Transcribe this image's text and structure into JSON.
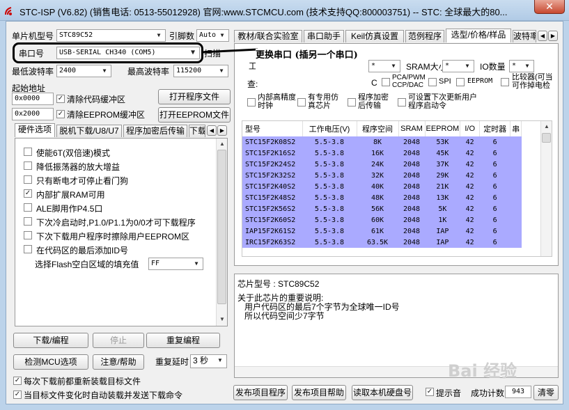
{
  "window": {
    "title": "STC-ISP (V6.82) (销售电话: 0513-55012928) 官网:www.STCMCU.com  (技术支持QQ:800003751)  -- STC: 全球最大的80..."
  },
  "left": {
    "mcu_type_label": "单片机型号",
    "mcu_type_value": "STC89C52",
    "pin_count_label": "引脚数",
    "pin_count_value": "Auto",
    "port_label": "串口号",
    "port_value": "USB-SERIAL CH340 (COM5)",
    "scan_label": "扫描",
    "min_baud_label": "最低波特率",
    "min_baud_value": "2400",
    "max_baud_label": "最高波特率",
    "max_baud_value": "115200",
    "start_addr_label": "起始地址",
    "addr1_value": "0x0000",
    "clear_code_label": "清除代码缓冲区",
    "open_program_label": "打开程序文件",
    "addr2_value": "0x2000",
    "clear_eeprom_label": "清除EEPROM缓冲区",
    "open_eeprom_label": "打开EEPROM文件",
    "tabs": [
      "硬件选项",
      "脱机下载/U8/U7",
      "程序加密后传输",
      "下载"
    ],
    "options": [
      {
        "label": "使能6T(双倍速)模式",
        "checked": false
      },
      {
        "label": "降低振荡器的放大增益",
        "checked": false
      },
      {
        "label": "只有断电才可停止看门狗",
        "checked": false
      },
      {
        "label": "内部扩展RAM可用",
        "checked": true
      },
      {
        "label": "ALE脚用作P4.5口",
        "checked": false
      },
      {
        "label": "下次冷启动时,P1.0/P1.1为0/0才可下载程序",
        "checked": false
      },
      {
        "label": "下次下载用户程序时擦除用户EEPROM区",
        "checked": false
      },
      {
        "label": "在代码区的最后添加ID号",
        "checked": false
      }
    ],
    "fill_label": "选择Flash空白区域的填充值",
    "fill_value": "FF",
    "download_label": "下载/编程",
    "stop_label": "停止",
    "reprogram_label": "重复编程",
    "detect_label": "检测MCU选项",
    "help_label": "注意/帮助",
    "retry_delay_label": "重复延时",
    "retry_delay_value": "3 秒",
    "reload_label": "每次下载前都重新装载目标文件",
    "autoload_label": "当目标文件变化时自动装载并发送下载命令"
  },
  "right": {
    "tabs": [
      "教材/联合实验室",
      "串口助手",
      "Keil仿真设置",
      "范例程序",
      "选型/价格/样品",
      "波特率"
    ],
    "filter": {
      "row1_label_a": "工",
      "any": "*",
      "sram_label": "SRAM大小",
      "io_label": "IO数量",
      "query_label": "查:",
      "c_label": "C",
      "pca_label": "PCA/PWM CCP/DAC",
      "spi_label": "SPI",
      "eeprom_label": "EEPROM",
      "comparator_label": "比较器(可当可作掉电检",
      "internal_clock_label": "内部高精度时钟",
      "emulator_label": "有专用仿真芯片",
      "encrypted_label": "程序加密后传输",
      "settable_label": "可设置下次更新用户程序启动令"
    },
    "table": {
      "headers": [
        "型号",
        "工作电压(V)",
        "程序空间",
        "SRAM",
        "EEPROM",
        "I/O",
        "定时器",
        "串"
      ],
      "rows": [
        [
          "STC15F2K08S2",
          "5.5-3.8",
          "8K",
          "2048",
          "53K",
          "42",
          "6"
        ],
        [
          "STC15F2K16S2",
          "5.5-3.8",
          "16K",
          "2048",
          "45K",
          "42",
          "6"
        ],
        [
          "STC15F2K24S2",
          "5.5-3.8",
          "24K",
          "2048",
          "37K",
          "42",
          "6"
        ],
        [
          "STC15F2K32S2",
          "5.5-3.8",
          "32K",
          "2048",
          "29K",
          "42",
          "6"
        ],
        [
          "STC15F2K40S2",
          "5.5-3.8",
          "40K",
          "2048",
          "21K",
          "42",
          "6"
        ],
        [
          "STC15F2K48S2",
          "5.5-3.8",
          "48K",
          "2048",
          "13K",
          "42",
          "6"
        ],
        [
          "STC15F2K56S2",
          "5.5-3.8",
          "56K",
          "2048",
          "5K",
          "42",
          "6"
        ],
        [
          "STC15F2K60S2",
          "5.5-3.8",
          "60K",
          "2048",
          "1K",
          "42",
          "6"
        ],
        [
          "IAP15F2K61S2",
          "5.5-3.8",
          "61K",
          "2048",
          "IAP",
          "42",
          "6"
        ],
        [
          "IRC15F2K63S2",
          "5.5-3.8",
          "63.5K",
          "2048",
          "IAP",
          "42",
          "6"
        ]
      ]
    },
    "info": {
      "chip_line": "芯片型号 : STC89C52",
      "note_title": "关于此芯片的重要说明:",
      "note_line1": "用户代码区的最后7个字节为全球唯一ID号",
      "note_line2": "所以代码空间少7字节"
    },
    "publish_label": "发布项目程序",
    "publish_help_label": "发布项目帮助",
    "read_disk_label": "读取本机硬盘号",
    "prompt_label": "提示音",
    "success_count_label": "成功计数",
    "success_count_value": "943",
    "clear_label": "清零"
  },
  "annotation": {
    "text": "更换串口 (插另一个串口)"
  },
  "watermark": "Bai 经验"
}
